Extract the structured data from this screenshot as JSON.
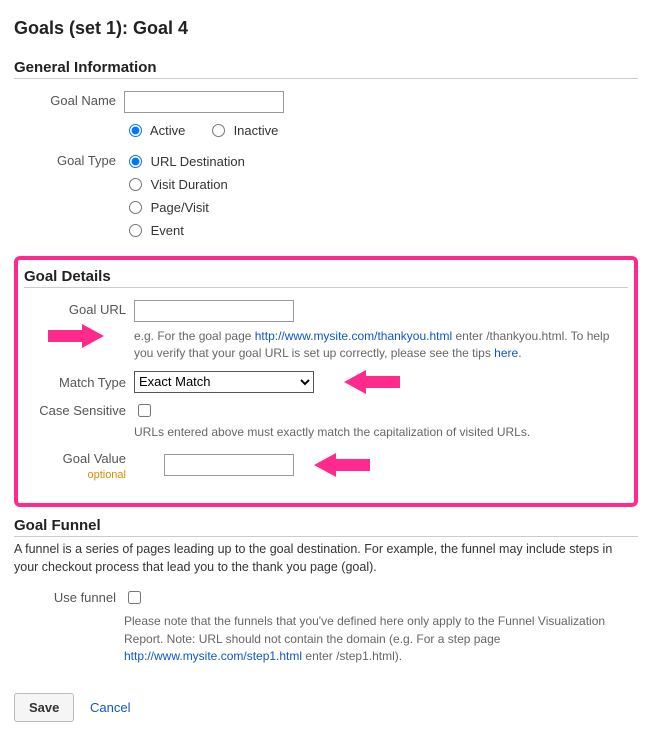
{
  "page_title": "Goals (set 1): Goal 4",
  "general": {
    "heading": "General Information",
    "name_label": "Goal Name",
    "status": {
      "active_label": "Active",
      "inactive_label": "Inactive"
    },
    "type_label": "Goal Type",
    "types": {
      "url_destination": "URL Destination",
      "visit_duration": "Visit Duration",
      "page_visit": "Page/Visit",
      "event": "Event"
    }
  },
  "details": {
    "heading": "Goal Details",
    "url_label": "Goal URL",
    "url_help_prefix": "e.g. For the goal page ",
    "url_help_link": "http://www.mysite.com/thankyou.html",
    "url_help_mid": " enter ",
    "url_help_path": "/thankyou.html",
    "url_help_suffix": ". To help you verify that your goal URL is set up correctly, please see the tips ",
    "url_help_here": "here",
    "match_label": "Match Type",
    "match_value": "Exact Match",
    "case_label": "Case Sensitive",
    "case_help": "URLs entered above must exactly match the capitalization of visited URLs.",
    "value_label": "Goal Value",
    "value_optional": "optional"
  },
  "funnel": {
    "heading": "Goal Funnel",
    "intro": "A funnel is a series of pages leading up to the goal destination. For example, the funnel may include steps in your checkout process that lead you to the thank you page (goal).",
    "use_label": "Use funnel",
    "help_prefix": "Please note that the funnels that you've defined here only apply to the Funnel Visualization Report. Note: URL should not contain the domain (e.g. For a step page ",
    "help_link": "http://www.mysite.com/step1.html",
    "help_mid": " enter ",
    "help_path": "/step1.html",
    "help_suffix": ")."
  },
  "actions": {
    "save": "Save",
    "cancel": "Cancel"
  }
}
